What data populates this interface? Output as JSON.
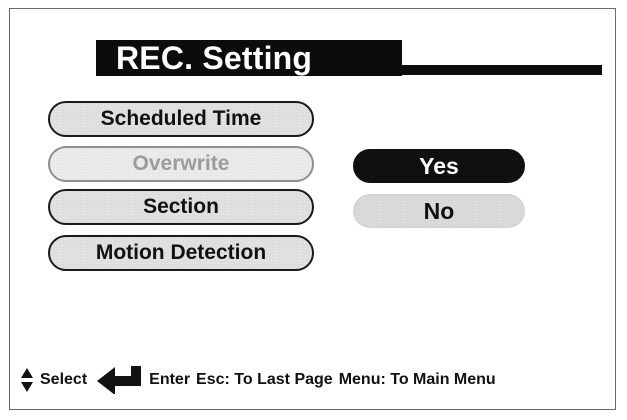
{
  "header": {
    "title": "REC. Setting"
  },
  "menu": {
    "items": [
      {
        "label": "Scheduled Time",
        "enabled": true
      },
      {
        "label": "Overwrite",
        "enabled": false
      },
      {
        "label": "Section",
        "enabled": true
      },
      {
        "label": "Motion Detection",
        "enabled": true
      }
    ]
  },
  "options": {
    "yes_label": "Yes",
    "no_label": "No",
    "selected": "Yes"
  },
  "footer": {
    "select_label": "Select",
    "enter_label": "Enter",
    "esc_text": "Esc: To Last Page",
    "menu_text": "Menu: To Main Menu"
  },
  "icons": {
    "select": "up-down-arrows-icon",
    "enter": "enter-arrow-icon"
  },
  "colors": {
    "background": "#ffffff",
    "header": "#0c0c0c",
    "button_fill": "#e2e2e2",
    "selected_fill": "#101010",
    "disabled_text": "#9c9c9c"
  }
}
